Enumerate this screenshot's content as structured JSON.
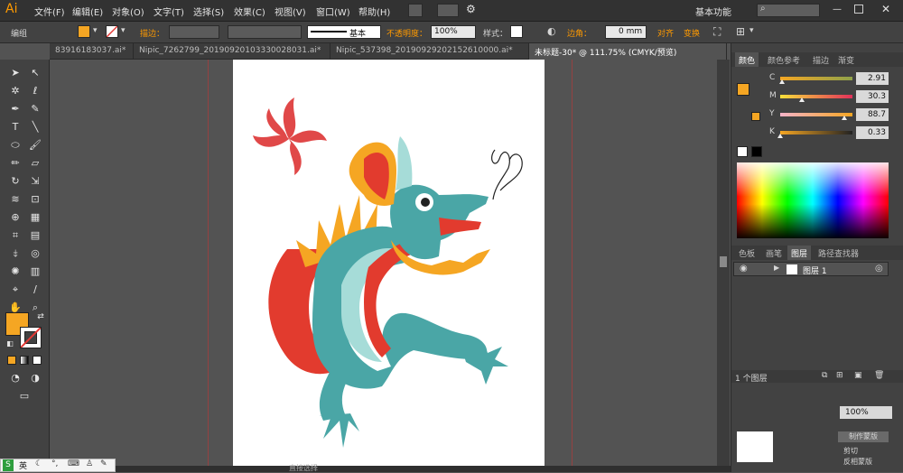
{
  "app": {
    "logo": "Ai"
  },
  "menu": {
    "items": [
      "文件(F)",
      "编辑(E)",
      "对象(O)",
      "文字(T)",
      "选择(S)",
      "效果(C)",
      "视图(V)",
      "窗口(W)",
      "帮助(H)"
    ],
    "workspace": "基本功能"
  },
  "control_bar": {
    "selection_label": "编组",
    "stroke_label": "描边：",
    "stroke_style": "基本",
    "opacity_label": "不透明度：",
    "opacity_value": "100%",
    "style_label": "样式：",
    "corner_label": "边角：",
    "corner_value": "0 mm",
    "align_label": "对齐",
    "transform_label": "变换"
  },
  "doc_tabs": [
    "83916183037.ai*",
    "Nipic_7262799_20190920103330028031.ai*",
    "Nipic_537398_20190929202152610000.ai*",
    "未标题-30* @ 111.75% (CMYK/预览)"
  ],
  "color_panel": {
    "tabs": [
      "颜色",
      "颜色参考",
      "描边",
      "渐变"
    ],
    "channels": [
      {
        "label": "C",
        "value": "2.91",
        "percent": 2.91
      },
      {
        "label": "M",
        "value": "30.3",
        "percent": 30.3
      },
      {
        "label": "Y",
        "value": "88.7",
        "percent": 88.7
      },
      {
        "label": "K",
        "value": "0.33",
        "percent": 0.33
      }
    ],
    "fill_color": "#f5a623"
  },
  "layers_panel": {
    "tabs": [
      "色板",
      "画笔",
      "图层",
      "路径查找器"
    ],
    "layer_name": "图层 1",
    "layer_count": "1 个图层"
  },
  "bottom_panel": {
    "opacity_value": "100%",
    "button_create": "制作蒙版",
    "option_clip": "剪切",
    "option_invert": "反相蒙版"
  },
  "status": {
    "selection_text": "直接选择"
  },
  "ime": {
    "lang": "英"
  },
  "colors": {
    "fill": "#f5a623",
    "stroke": "#e53935",
    "accent": "#ff9a00"
  }
}
